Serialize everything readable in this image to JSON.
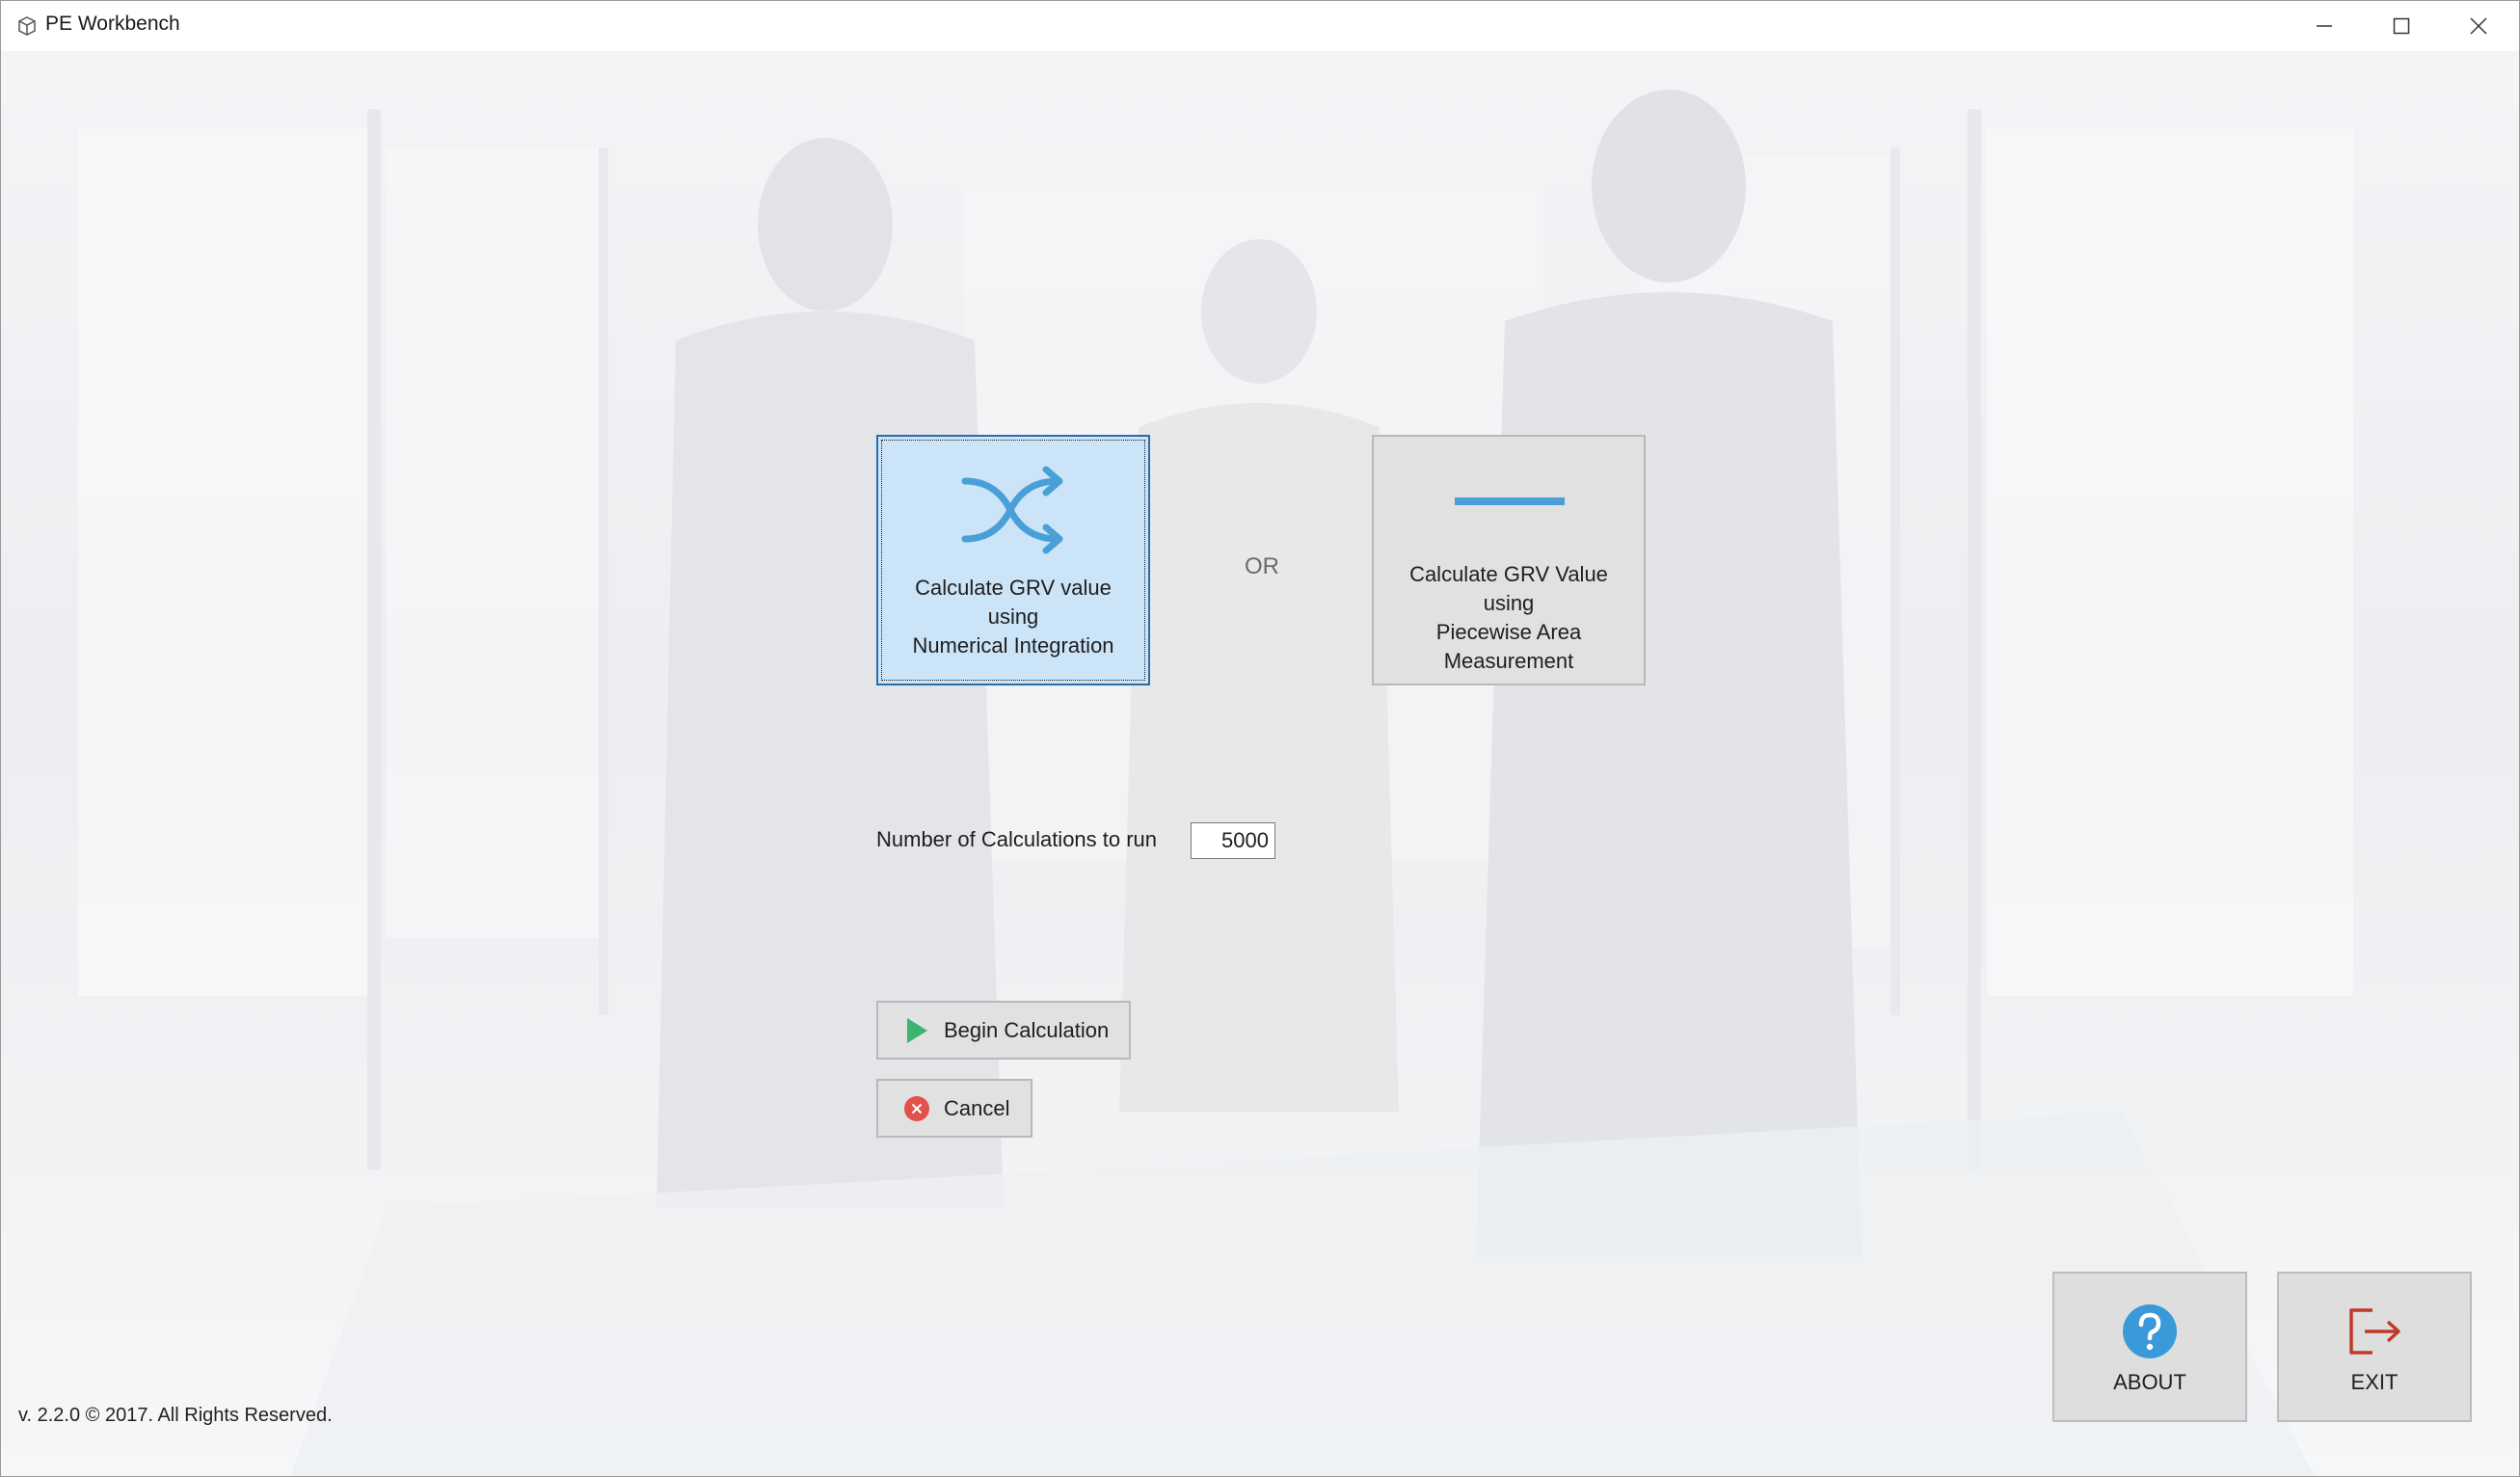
{
  "window": {
    "title": "PE Workbench"
  },
  "options": {
    "numerical": {
      "line1": "Calculate GRV value",
      "line2": "using",
      "line3": "Numerical Integration"
    },
    "or_label": "OR",
    "piecewise": {
      "line1": "Calculate GRV Value",
      "line2": "using",
      "line3": "Piecewise Area",
      "line4": "Measurement"
    }
  },
  "calculations": {
    "label": "Number of Calculations to run",
    "value": "5000"
  },
  "actions": {
    "begin_label": "Begin Calculation",
    "cancel_label": "Cancel"
  },
  "footer": {
    "about_label": "ABOUT",
    "exit_label": "EXIT",
    "version": "v. 2.2.0 © 2017. All Rights Reserved."
  },
  "colors": {
    "accent_blue": "#4a9fd8",
    "selected_tile": "#cce4f7",
    "play_green": "#3cb371",
    "cancel_red": "#e0524a",
    "exit_red": "#c0392b"
  }
}
